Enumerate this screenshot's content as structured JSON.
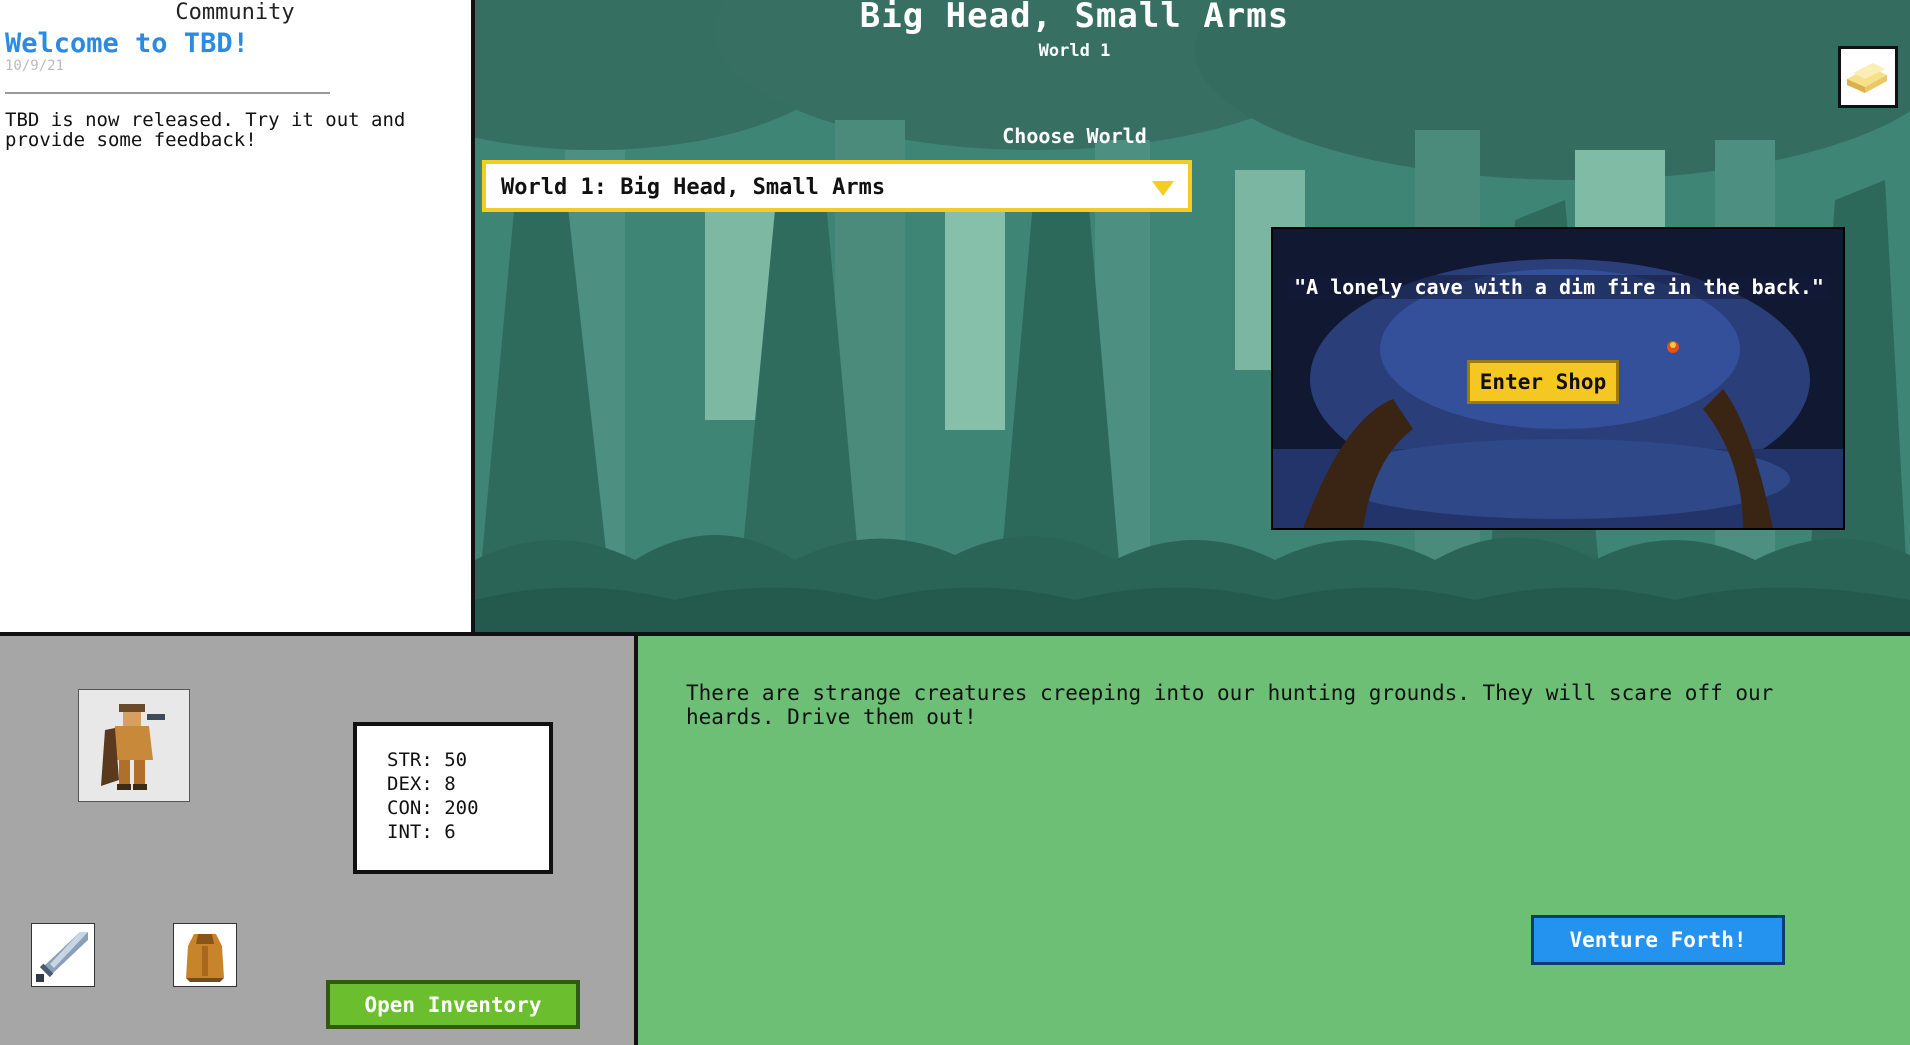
{
  "community": {
    "title": "Community",
    "post": {
      "title": "Welcome to TBD!",
      "date": "10/9/21",
      "body": "TBD is now released. Try it out and provide some feedback!"
    }
  },
  "world": {
    "title": "Big Head, Small Arms",
    "subtitle": "World 1",
    "choose_label": "Choose World",
    "selected_world": "World 1: Big Head, Small Arms",
    "shop": {
      "description": "\"A lonely cave with a dim fire in the back.\"",
      "enter_label": "Enter Shop"
    },
    "bag_icon": "gold-bars-icon"
  },
  "character": {
    "portrait_icon": "hero-portrait-icon",
    "stats": [
      {
        "label": "STR:",
        "value": "50"
      },
      {
        "label": "DEX:",
        "value": "8"
      },
      {
        "label": "CON:",
        "value": "200"
      },
      {
        "label": "INT:",
        "value": "6"
      }
    ],
    "equipment": {
      "weapon_icon": "sword-icon",
      "armor_icon": "armor-icon"
    },
    "inventory_label": "Open Inventory"
  },
  "quest": {
    "text": "There are strange creatures creeping into our hunting grounds. They will scare off our heards. Drive them out!",
    "venture_label": "Venture Forth!"
  },
  "colors": {
    "accent_blue": "#2a8be0",
    "select_border": "#f3cc24",
    "shop_button": "#f5c723",
    "inventory_button": "#6bbf2f",
    "venture_button": "#2393ef",
    "quest_bg": "#6cbf75",
    "character_bg": "#a6a6a6",
    "forest_bg": "#3f8574"
  }
}
